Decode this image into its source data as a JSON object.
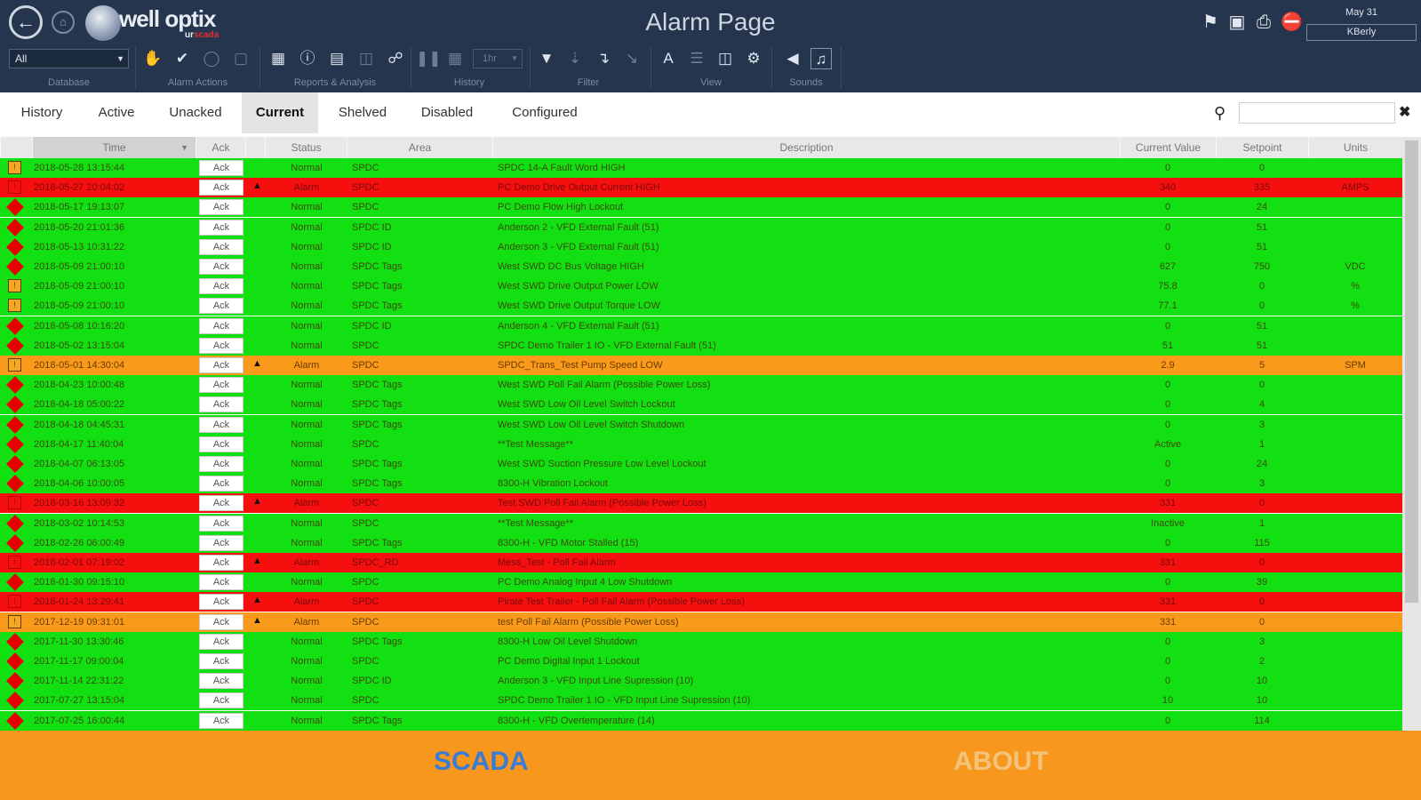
{
  "app": {
    "title": "Alarm Page",
    "logo_text": "well optix",
    "logo_sub_white": "ur",
    "logo_sub_red": "scada",
    "user_date": "May 31",
    "user_name": "KBerly",
    "colors": {
      "navy": "#25354d",
      "normal": "#13e013",
      "alarm_red": "#f60f0f",
      "alarm_orange": "#f99a1b",
      "bottom": "#f7971d",
      "scada_tab": "#3a7bd5"
    }
  },
  "nav": {
    "back_icon": "arrow-left-icon",
    "home_icon": "home-icon"
  },
  "right_icons": [
    "tag-icon",
    "save-icon",
    "print-icon",
    "mute-icon"
  ],
  "toolbar": {
    "database": {
      "label": "Database",
      "value": "All"
    },
    "alarm_actions": {
      "label": "Alarm Actions",
      "icons": [
        "bell-hand-icon",
        "check-icon",
        "shelve-icon",
        "disable-icon"
      ]
    },
    "reports": {
      "label": "Reports & Analysis",
      "icons": [
        "chart-icon",
        "info-icon",
        "report-icon",
        "document-icon",
        "link-icon"
      ]
    },
    "history": {
      "label": "History",
      "icons": [
        "pause-icon",
        "calendar-icon"
      ],
      "range_value": "1hr"
    },
    "filter": {
      "label": "Filter",
      "icons": [
        "filter-icon",
        "filter-sort-icon",
        "filter-column-icon",
        "filter-clear-icon"
      ]
    },
    "view": {
      "label": "View",
      "icons": [
        "font-icon",
        "rows-icon",
        "columns-icon",
        "gear-icon"
      ]
    },
    "sounds": {
      "label": "Sounds",
      "icons": [
        "speaker-icon",
        "volume-icon"
      ]
    }
  },
  "tabs": [
    "History",
    "Active",
    "Unacked",
    "Current",
    "Shelved",
    "Disabled",
    "Configured"
  ],
  "active_tab": "Current",
  "search": {
    "value": "",
    "placeholder": ""
  },
  "table": {
    "columns": [
      "Time",
      "Ack",
      "Status",
      "Area",
      "Description",
      "Current Value",
      "Setpoint",
      "Units"
    ],
    "rows": [
      {
        "sev": "square",
        "color": "green",
        "time": "2018-05-28 13:15:44",
        "ack": "Ack",
        "bell": false,
        "status": "Normal",
        "area": "SPDC",
        "desc": "SPDC 14-A Fault Word HIGH",
        "value": "0",
        "setpoint": "0",
        "units": ""
      },
      {
        "sev": "square-red",
        "color": "red",
        "time": "2018-05-27 20:04:02",
        "ack": "Ack",
        "bell": true,
        "status": "Alarm",
        "area": "SPDC",
        "desc": "PC Demo Drive Output Current HIGH",
        "value": "340",
        "setpoint": "335",
        "units": "AMPS"
      },
      {
        "sev": "diamond",
        "color": "green",
        "time": "2018-05-17 19:13:07",
        "ack": "Ack",
        "bell": false,
        "status": "Normal",
        "area": "SPDC",
        "desc": "PC Demo Flow High Lockout",
        "value": "0",
        "setpoint": "24",
        "units": ""
      },
      {
        "sev": "diamond",
        "color": "green",
        "time": "2018-05-20 21:01:36",
        "ack": "Ack",
        "bell": false,
        "status": "Normal",
        "area": "SPDC ID",
        "desc": "Anderson 2 - VFD External Fault (51)",
        "value": "0",
        "setpoint": "51",
        "units": ""
      },
      {
        "sev": "diamond",
        "color": "green",
        "time": "2018-05-13 10:31:22",
        "ack": "Ack",
        "bell": false,
        "status": "Normal",
        "area": "SPDC ID",
        "desc": "Anderson 3 - VFD External Fault (51)",
        "value": "0",
        "setpoint": "51",
        "units": ""
      },
      {
        "sev": "diamond",
        "color": "green",
        "time": "2018-05-09 21:00:10",
        "ack": "Ack",
        "bell": false,
        "status": "Normal",
        "area": "SPDC Tags",
        "desc": "West SWD DC Bus Voltage HIGH",
        "value": "627",
        "setpoint": "750",
        "units": "VDC"
      },
      {
        "sev": "square",
        "color": "green",
        "time": "2018-05-09 21:00:10",
        "ack": "Ack",
        "bell": false,
        "status": "Normal",
        "area": "SPDC Tags",
        "desc": "West SWD Drive Output Power LOW",
        "value": "75.8",
        "setpoint": "0",
        "units": "%"
      },
      {
        "sev": "square",
        "color": "green",
        "time": "2018-05-09 21:00:10",
        "ack": "Ack",
        "bell": false,
        "status": "Normal",
        "area": "SPDC Tags",
        "desc": "West SWD Drive Output Torque LOW",
        "value": "77.1",
        "setpoint": "0",
        "units": "%"
      },
      {
        "sev": "diamond",
        "color": "green",
        "time": "2018-05-08 10:16:20",
        "ack": "Ack",
        "bell": false,
        "status": "Normal",
        "area": "SPDC ID",
        "desc": "Anderson 4 - VFD External Fault (51)",
        "value": "0",
        "setpoint": "51",
        "units": ""
      },
      {
        "sev": "diamond",
        "color": "green",
        "time": "2018-05-02 13:15:04",
        "ack": "Ack",
        "bell": false,
        "status": "Normal",
        "area": "SPDC",
        "desc": "SPDC Demo Trailer 1 IO - VFD External Fault (51)",
        "value": "51",
        "setpoint": "51",
        "units": ""
      },
      {
        "sev": "square",
        "color": "orange",
        "time": "2018-05-01 14:30:04",
        "ack": "Ack",
        "bell": true,
        "status": "Alarm",
        "area": "SPDC",
        "desc": "SPDC_Trans_Test Pump Speed LOW",
        "value": "2.9",
        "setpoint": "5",
        "units": "SPM"
      },
      {
        "sev": "diamond",
        "color": "green",
        "time": "2018-04-23 10:00:48",
        "ack": "Ack",
        "bell": false,
        "status": "Normal",
        "area": "SPDC Tags",
        "desc": "West SWD Poll Fail Alarm (Possible Power Loss)",
        "value": "0",
        "setpoint": "0",
        "units": ""
      },
      {
        "sev": "diamond",
        "color": "green",
        "time": "2018-04-18 05:00:22",
        "ack": "Ack",
        "bell": false,
        "status": "Normal",
        "area": "SPDC Tags",
        "desc": "West SWD Low Oil Level Switch Lockout",
        "value": "0",
        "setpoint": "4",
        "units": ""
      },
      {
        "sev": "diamond",
        "color": "green",
        "time": "2018-04-18 04:45:31",
        "ack": "Ack",
        "bell": false,
        "status": "Normal",
        "area": "SPDC Tags",
        "desc": "West SWD Low Oil Level Switch Shutdown",
        "value": "0",
        "setpoint": "3",
        "units": ""
      },
      {
        "sev": "diamond",
        "color": "green",
        "time": "2018-04-17 11:40:04",
        "ack": "Ack",
        "bell": false,
        "status": "Normal",
        "area": "SPDC",
        "desc": "**Test Message**",
        "value": "Active",
        "setpoint": "1",
        "units": ""
      },
      {
        "sev": "diamond",
        "color": "green",
        "time": "2018-04-07 06:13:05",
        "ack": "Ack",
        "bell": false,
        "status": "Normal",
        "area": "SPDC Tags",
        "desc": "West SWD Suction Pressure Low Level Lockout",
        "value": "0",
        "setpoint": "24",
        "units": ""
      },
      {
        "sev": "diamond",
        "color": "green",
        "time": "2018-04-06 10:00:05",
        "ack": "Ack",
        "bell": false,
        "status": "Normal",
        "area": "SPDC Tags",
        "desc": "8300-H Vibration Lockout",
        "value": "0",
        "setpoint": "3",
        "units": ""
      },
      {
        "sev": "square-red",
        "color": "red",
        "time": "2018-03-16 13:09:32",
        "ack": "Ack",
        "bell": true,
        "status": "Alarm",
        "area": "SPDC",
        "desc": "Test SWD Poll Fail Alarm (Possible Power Loss)",
        "value": "331",
        "setpoint": "0",
        "units": ""
      },
      {
        "sev": "diamond",
        "color": "green",
        "time": "2018-03-02 10:14:53",
        "ack": "Ack",
        "bell": false,
        "status": "Normal",
        "area": "SPDC",
        "desc": "**Test Message**",
        "value": "Inactive",
        "setpoint": "1",
        "units": ""
      },
      {
        "sev": "diamond",
        "color": "green",
        "time": "2018-02-26 06:00:49",
        "ack": "Ack",
        "bell": false,
        "status": "Normal",
        "area": "SPDC Tags",
        "desc": "8300-H - VFD Motor Stalled (15)",
        "value": "0",
        "setpoint": "115",
        "units": ""
      },
      {
        "sev": "square-red",
        "color": "red",
        "time": "2018-02-01 07:19:02",
        "ack": "Ack",
        "bell": true,
        "status": "Alarm",
        "area": "SPDC_RD",
        "desc": "Mess_Test - Poll Fail Alarm",
        "value": "331",
        "setpoint": "0",
        "units": ""
      },
      {
        "sev": "diamond",
        "color": "green",
        "time": "2018-01-30 09:15:10",
        "ack": "Ack",
        "bell": false,
        "status": "Normal",
        "area": "SPDC",
        "desc": "PC Demo Analog Input 4 Low Shutdown",
        "value": "0",
        "setpoint": "39",
        "units": ""
      },
      {
        "sev": "square-red",
        "color": "red",
        "time": "2018-01-24 13:29:41",
        "ack": "Ack",
        "bell": true,
        "status": "Alarm",
        "area": "SPDC",
        "desc": "Pirate Test Trailer - Poll Fail Alarm (Possible Power Loss)",
        "value": "331",
        "setpoint": "0",
        "units": ""
      },
      {
        "sev": "square",
        "color": "orange",
        "time": "2017-12-19 09:31:01",
        "ack": "Ack",
        "bell": true,
        "status": "Alarm",
        "area": "SPDC",
        "desc": "test Poll Fail Alarm (Possible Power Loss)",
        "value": "331",
        "setpoint": "0",
        "units": ""
      },
      {
        "sev": "diamond",
        "color": "green",
        "time": "2017-11-30 13:30:46",
        "ack": "Ack",
        "bell": false,
        "status": "Normal",
        "area": "SPDC Tags",
        "desc": "8300-H Low Oil Level Shutdown",
        "value": "0",
        "setpoint": "3",
        "units": ""
      },
      {
        "sev": "diamond",
        "color": "green",
        "time": "2017-11-17 09:00:04",
        "ack": "Ack",
        "bell": false,
        "status": "Normal",
        "area": "SPDC",
        "desc": "PC Demo Digital Input 1 Lockout",
        "value": "0",
        "setpoint": "2",
        "units": ""
      },
      {
        "sev": "diamond",
        "color": "green",
        "time": "2017-11-14 22:31:22",
        "ack": "Ack",
        "bell": false,
        "status": "Normal",
        "area": "SPDC ID",
        "desc": "Anderson 3 - VFD Input Line Supression (10)",
        "value": "0",
        "setpoint": "10",
        "units": ""
      },
      {
        "sev": "diamond",
        "color": "green",
        "time": "2017-07-27 13:15:04",
        "ack": "Ack",
        "bell": false,
        "status": "Normal",
        "area": "SPDC",
        "desc": "SPDC Demo Trailer 1 IO - VFD Input Line Supression (10)",
        "value": "10",
        "setpoint": "10",
        "units": ""
      },
      {
        "sev": "diamond",
        "color": "green",
        "time": "2017-07-25 16:00:44",
        "ack": "Ack",
        "bell": false,
        "status": "Normal",
        "area": "SPDC Tags",
        "desc": "8300-H - VFD Overtemperature (14)",
        "value": "0",
        "setpoint": "114",
        "units": ""
      }
    ]
  },
  "bottom_tabs": [
    "SCADA",
    "ABOUT"
  ]
}
